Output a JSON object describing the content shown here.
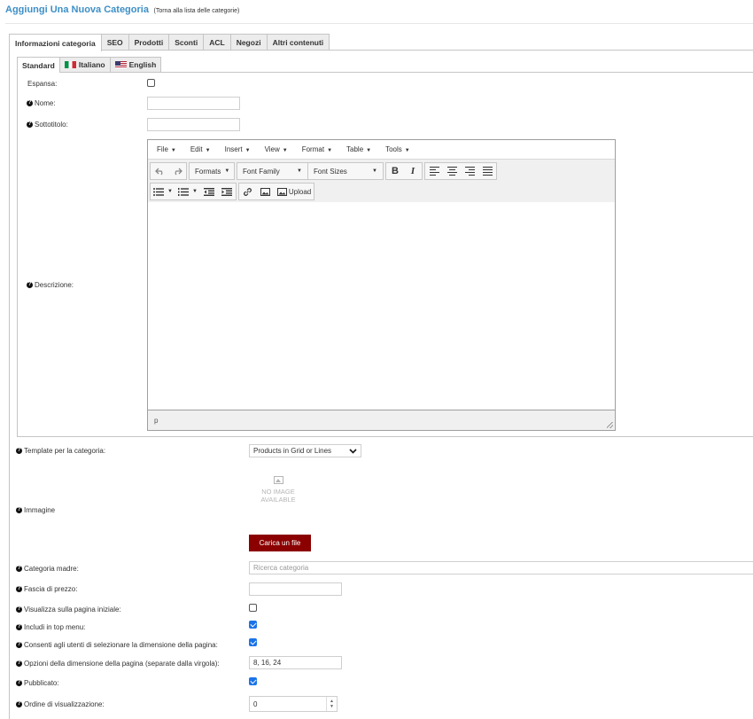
{
  "header": {
    "title": "Aggiungi Una Nuova Categoria",
    "back_link": "(Torna alla lista delle categorie)"
  },
  "tabs": [
    {
      "label": "Informazioni categoria",
      "active": true
    },
    {
      "label": "SEO"
    },
    {
      "label": "Prodotti"
    },
    {
      "label": "Sconti"
    },
    {
      "label": "ACL"
    },
    {
      "label": "Negozi"
    },
    {
      "label": "Altri contenuti"
    }
  ],
  "language_tabs": [
    {
      "label": "Standard",
      "active": true
    },
    {
      "label": "Italiano",
      "flag": "italy-flag-icon"
    },
    {
      "label": "English",
      "flag": "usa-flag-icon"
    }
  ],
  "form": {
    "espansa_label": "Espansa:",
    "espansa_checked": false,
    "nome_label": "Nome:",
    "nome_value": "",
    "sottotitolo_label": "Sottotitolo:",
    "sottotitolo_value": "",
    "descrizione_label": "Descrizione:",
    "template_label": "Template per la categoria:",
    "template_value": "Products in Grid or Lines",
    "immagine_label": "Immagine",
    "no_image_line1": "NO IMAGE",
    "no_image_line2": "AVAILABLE",
    "upload_button": "Carica un file",
    "categoria_madre_label": "Categoria madre:",
    "categoria_madre_placeholder": "Ricerca categoria",
    "fascia_prezzo_label": "Fascia di prezzo:",
    "fascia_prezzo_value": "",
    "visualizza_label": "Visualizza sulla pagina iniziale:",
    "visualizza_checked": false,
    "top_menu_label": "Includi in top menu:",
    "top_menu_checked": true,
    "consenti_label": "Consenti agli utenti di selezionare la dimensione della pagina:",
    "consenti_checked": true,
    "opzioni_label": "Opzioni della dimensione della pagina (separate dalla virgola):",
    "opzioni_value": "8, 16, 24",
    "pubblicato_label": "Pubblicato:",
    "pubblicato_checked": true,
    "ordine_label": "Ordine di visualizzazione:",
    "ordine_value": "0"
  },
  "editor": {
    "menu": [
      "File",
      "Edit",
      "Insert",
      "View",
      "Format",
      "Table",
      "Tools"
    ],
    "formats": "Formats",
    "font_family": "Font Family",
    "font_sizes": "Font Sizes",
    "bold": "B",
    "italic": "I",
    "upload": "Upload",
    "status_path": "p"
  },
  "colors": {
    "title": "#3d8fc7",
    "upload_button": "#8b0000",
    "checkbox_checked": "#1a73e8"
  }
}
